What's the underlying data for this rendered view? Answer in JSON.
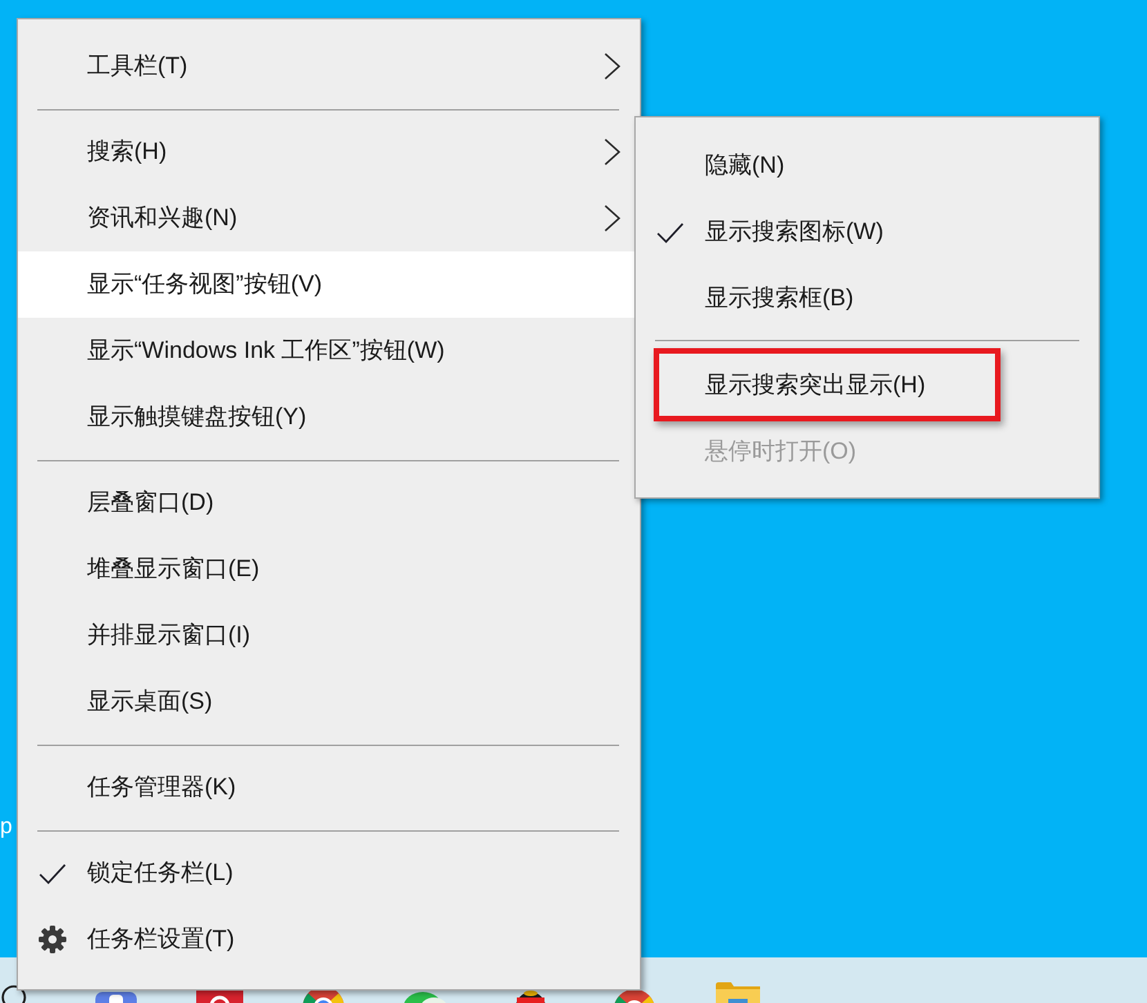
{
  "desktop": {
    "icon_label": "p"
  },
  "context_menu": {
    "groups": [
      {
        "items": [
          {
            "label": "工具栏(T)",
            "has_submenu": true,
            "selected": false,
            "checked": false,
            "icon": false
          }
        ]
      },
      {
        "items": [
          {
            "label": "搜索(H)",
            "has_submenu": true,
            "selected": false,
            "checked": false,
            "icon": false
          },
          {
            "label": "资讯和兴趣(N)",
            "has_submenu": true,
            "selected": false,
            "checked": false,
            "icon": false
          },
          {
            "label": "显示“任务视图”按钮(V)",
            "has_submenu": false,
            "selected": true,
            "checked": false,
            "icon": false
          },
          {
            "label": "显示“Windows Ink 工作区”按钮(W)",
            "has_submenu": false,
            "selected": false,
            "checked": false,
            "icon": false
          },
          {
            "label": "显示触摸键盘按钮(Y)",
            "has_submenu": false,
            "selected": false,
            "checked": false,
            "icon": false
          }
        ]
      },
      {
        "items": [
          {
            "label": "层叠窗口(D)",
            "has_submenu": false,
            "selected": false,
            "checked": false,
            "icon": false
          },
          {
            "label": "堆叠显示窗口(E)",
            "has_submenu": false,
            "selected": false,
            "checked": false,
            "icon": false
          },
          {
            "label": "并排显示窗口(I)",
            "has_submenu": false,
            "selected": false,
            "checked": false,
            "icon": false
          },
          {
            "label": "显示桌面(S)",
            "has_submenu": false,
            "selected": false,
            "checked": false,
            "icon": false
          }
        ]
      },
      {
        "items": [
          {
            "label": "任务管理器(K)",
            "has_submenu": false,
            "selected": false,
            "checked": false,
            "icon": false
          }
        ]
      },
      {
        "items": [
          {
            "label": "锁定任务栏(L)",
            "has_submenu": false,
            "selected": false,
            "checked": true,
            "icon": false
          },
          {
            "label": "任务栏设置(T)",
            "has_submenu": false,
            "selected": false,
            "checked": false,
            "icon": true
          }
        ]
      }
    ]
  },
  "submenu": {
    "groups": [
      {
        "items": [
          {
            "label": "隐藏(N)",
            "checked": false,
            "disabled": false,
            "highlighted": false
          },
          {
            "label": "显示搜索图标(W)",
            "checked": true,
            "disabled": false,
            "highlighted": false
          },
          {
            "label": "显示搜索框(B)",
            "checked": false,
            "disabled": false,
            "highlighted": false
          }
        ]
      },
      {
        "items": [
          {
            "label": "显示搜索突出显示(H)",
            "checked": false,
            "disabled": false,
            "highlighted": true
          },
          {
            "label": "悬停时打开(O)",
            "checked": false,
            "disabled": true,
            "highlighted": false
          }
        ]
      }
    ]
  }
}
